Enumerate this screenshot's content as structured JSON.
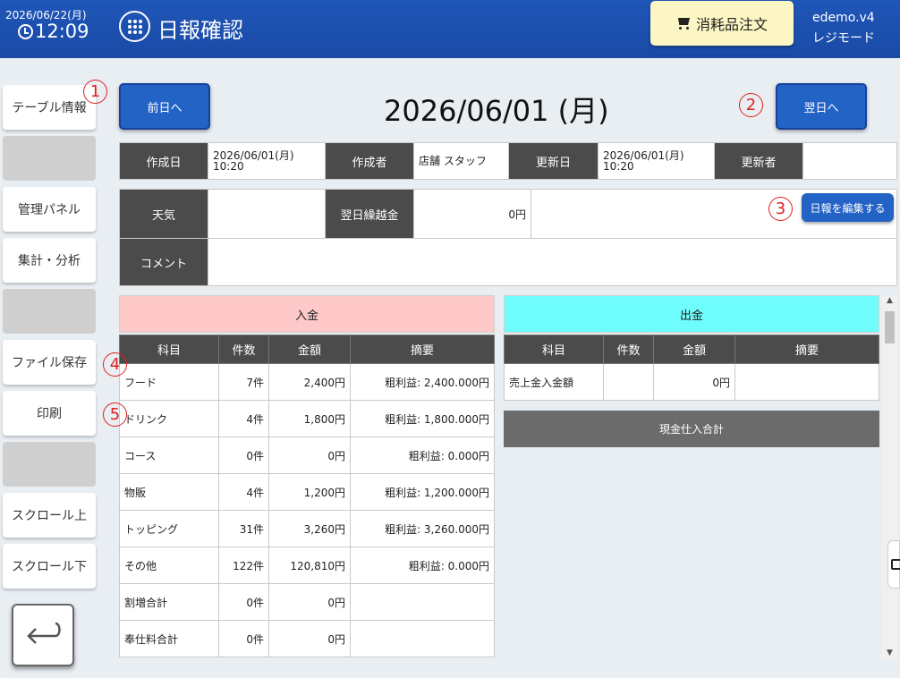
{
  "header": {
    "date": "2026/06/22(月)",
    "time": "12:09",
    "title": "日報確認",
    "order_button": "消耗品注文",
    "user_line1": "edemo.v4",
    "user_line2": "レジモード"
  },
  "sidebar": {
    "items": [
      {
        "label": "テーブル情報"
      },
      {
        "label": ""
      },
      {
        "label": "管理パネル"
      },
      {
        "label": "集計・分析"
      },
      {
        "label": ""
      },
      {
        "label": "ファイル保存"
      },
      {
        "label": "印刷"
      },
      {
        "label": ""
      },
      {
        "label": "スクロール上"
      },
      {
        "label": "スクロール下"
      }
    ]
  },
  "markers": [
    "1",
    "2",
    "3",
    "4",
    "5"
  ],
  "nav": {
    "prev": "前日へ",
    "next": "翌日へ",
    "date": "2026/06/01 (月)"
  },
  "meta": {
    "created_label": "作成日",
    "created_date": "2026/06/01(月)",
    "created_time": "10:20",
    "author_label": "作成者",
    "author": "店舗 スタッフ",
    "updated_label": "更新日",
    "updated_date": "2026/06/01(月)",
    "updated_time": "10:20",
    "updater_label": "更新者",
    "updater": ""
  },
  "details": {
    "weather_label": "天気",
    "weather": "",
    "carryover_label": "翌日繰越金",
    "carryover": "0円",
    "edit_button": "日報を編集する",
    "comment_label": "コメント",
    "comment": ""
  },
  "income": {
    "title": "入金",
    "columns": [
      "科目",
      "件数",
      "金額",
      "摘要"
    ],
    "rows": [
      {
        "item": "フード",
        "count": "7件",
        "amount": "2,400円",
        "note": "粗利益: 2,400.000円"
      },
      {
        "item": "ドリンク",
        "count": "4件",
        "amount": "1,800円",
        "note": "粗利益: 1,800.000円"
      },
      {
        "item": "コース",
        "count": "0件",
        "amount": "0円",
        "note": "粗利益: 0.000円"
      },
      {
        "item": "物販",
        "count": "4件",
        "amount": "1,200円",
        "note": "粗利益: 1,200.000円"
      },
      {
        "item": "トッピング",
        "count": "31件",
        "amount": "3,260円",
        "note": "粗利益: 3,260.000円"
      },
      {
        "item": "その他",
        "count": "122件",
        "amount": "120,810円",
        "note": "粗利益: 0.000円"
      },
      {
        "item": "割増合計",
        "count": "0件",
        "amount": "0円",
        "note": ""
      },
      {
        "item": "奉仕料合計",
        "count": "0件",
        "amount": "0円",
        "note": ""
      }
    ]
  },
  "expense": {
    "title": "出金",
    "columns": [
      "科目",
      "件数",
      "金額",
      "摘要"
    ],
    "rows": [
      {
        "item": "売上金入金額",
        "count": "",
        "amount": "0円",
        "note": ""
      }
    ],
    "cash_total": "現金仕入合計"
  },
  "colors": {
    "header": "#1f56b8",
    "income_head": "#ffc9c9",
    "expense_head": "#6efcfc",
    "nav_button": "#2463c6",
    "order_button": "#fbf6c3"
  }
}
